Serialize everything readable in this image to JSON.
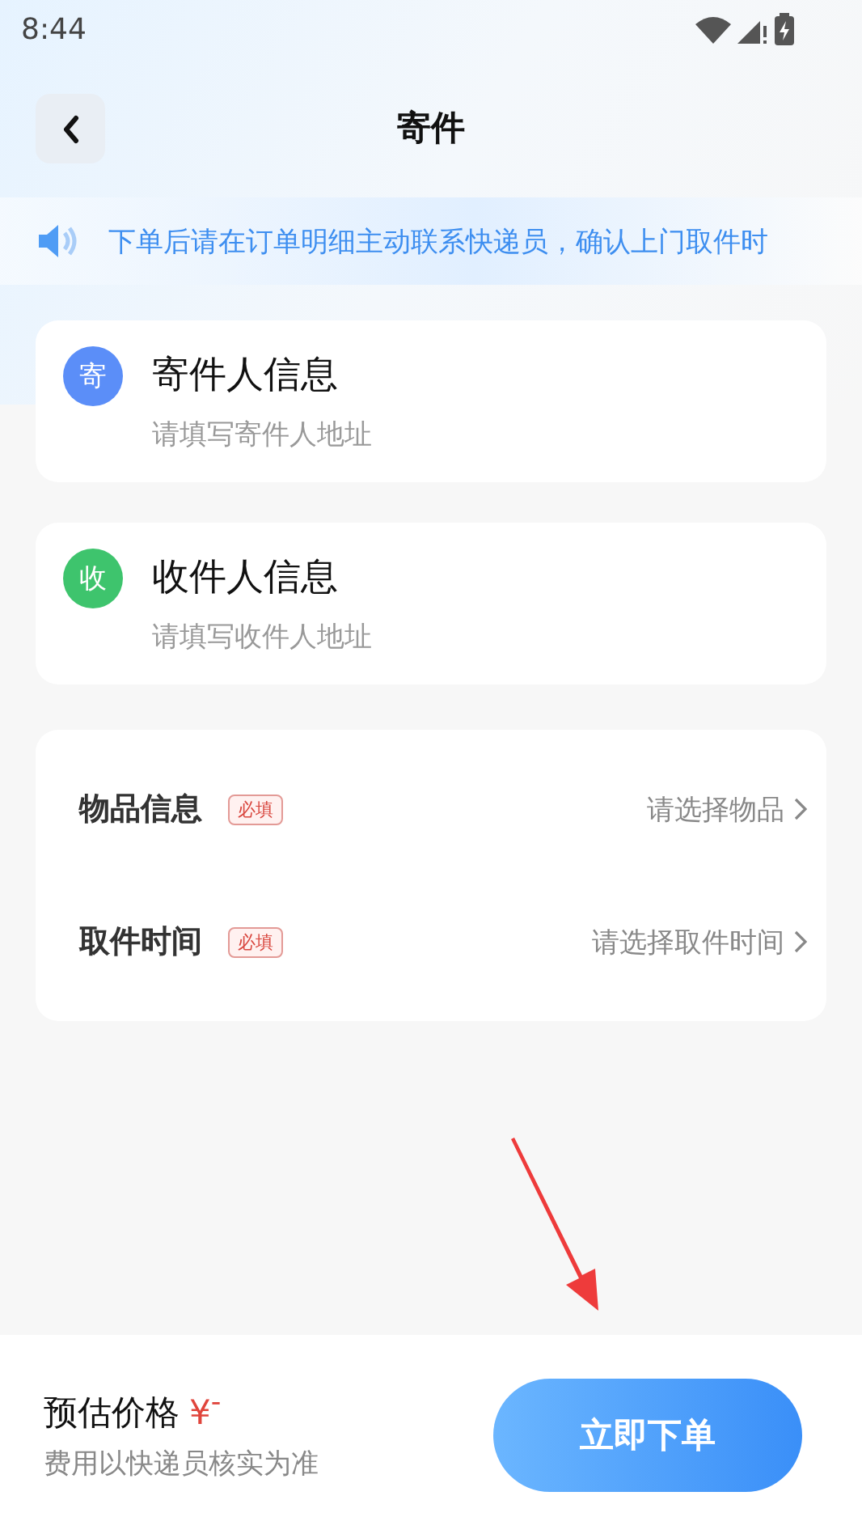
{
  "status_bar": {
    "time": "8:44"
  },
  "header": {
    "title": "寄件"
  },
  "notice": {
    "text": "下单后请在订单明细主动联系快递员，确认上门取件时"
  },
  "contacts": [
    {
      "badge": "寄",
      "color": "#5b8ef8",
      "title": "寄件人信息",
      "placeholder": "请填写寄件人地址"
    },
    {
      "badge": "收",
      "color": "#3ec46d",
      "title": "收件人信息",
      "placeholder": "请填写收件人地址"
    }
  ],
  "fields": [
    {
      "label": "物品信息",
      "tag": "必填",
      "value": "请选择物品"
    },
    {
      "label": "取件时间",
      "tag": "必填",
      "value": "请选择取件时间"
    }
  ],
  "footer": {
    "price_label": "预估价格",
    "price": "¥$^{-}$",
    "note": "费用以快递员核实为准",
    "button": "立即下单"
  }
}
